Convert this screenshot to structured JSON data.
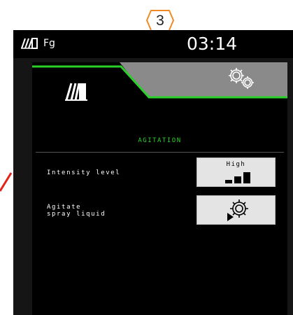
{
  "callout": {
    "number": "3"
  },
  "status_bar": {
    "machine_label": "Fg",
    "time": "03:14"
  },
  "tabs": [
    {
      "icon": "sprayer-boom-icon",
      "active": true
    },
    {
      "icon": "gears-settings-icon",
      "active": false
    }
  ],
  "section": {
    "title": "AGITATION"
  },
  "rows": [
    {
      "label": "Intensity level",
      "button_text": "High",
      "button_icon": "intensity-bars-icon",
      "level_index": 3,
      "level_count": 3
    },
    {
      "label": "Agitate\nspray liquid",
      "button_icon": "gear-play-icon"
    }
  ],
  "colors": {
    "accent_green": "#2bd12b",
    "callout_orange": "#f08a24",
    "button_bg": "#e4e4e4",
    "tab_gray": "#8a8a8a",
    "pointer_red": "#e2231a"
  }
}
